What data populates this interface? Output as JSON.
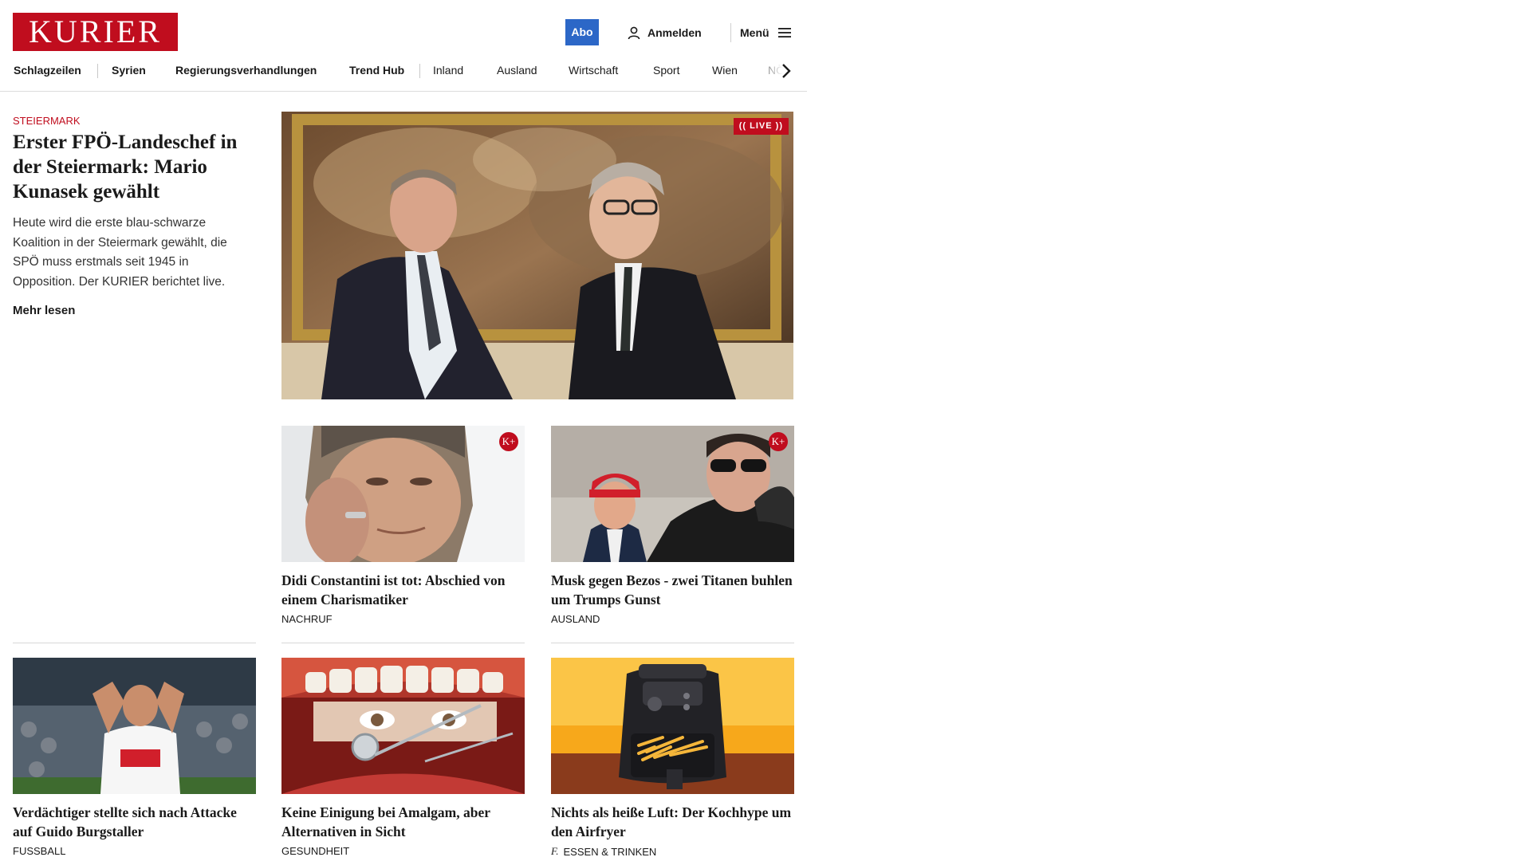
{
  "brand": {
    "logo": "KURIER",
    "accent": "#c00d1e",
    "abo_color": "#2c67c7"
  },
  "header": {
    "abo_label": "Abo",
    "login_label": "Anmelden",
    "menu_label": "Menü"
  },
  "nav": {
    "items": [
      "Schlagzeilen",
      "Syrien",
      "Regierungsverhandlungen",
      "Trend Hub",
      "Inland",
      "Ausland",
      "Wirtschaft",
      "Sport",
      "Wien",
      "NÖ"
    ]
  },
  "lead": {
    "category": "Steiermark",
    "title": "Erster FPÖ-Landeschef in der Steiermark: Mario Kunasek gewählt",
    "teaser": "Heute wird die erste blau-schwarze Koalition in der Steiermark gewählt, die SPÖ muss erstmals seit 1945 in Opposition. Der KURIER berichtet live.",
    "more_label": "Mehr lesen",
    "live_label": "LIVE"
  },
  "cards": [
    {
      "title": "Didi Constantini ist tot: Abschied von einem Charismatiker",
      "category": "Nachruf",
      "premium": "K+"
    },
    {
      "title": "Musk gegen Bezos - zwei Titanen buhlen um Trumps Gunst",
      "category": "Ausland",
      "premium": "K+"
    },
    {
      "title": "Verdächtiger stellte sich nach Atta­cke auf Guido Burgstaller",
      "category": "Fussball"
    },
    {
      "title": "Keine Einigung bei Amalgam, aber Alternativen in Sicht",
      "category": "Gesundheit"
    },
    {
      "title": "Nichts als heiße Luft: Der Koch­hype um den Airfryer",
      "category": "Essen & Trinken",
      "badge": "f."
    }
  ]
}
